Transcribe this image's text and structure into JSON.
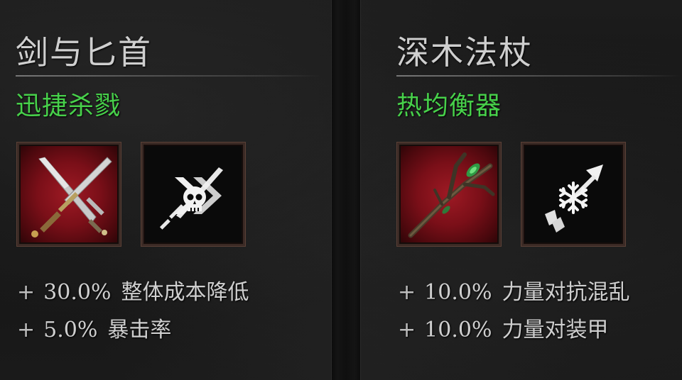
{
  "left_panel": {
    "title": "剑与匕首",
    "subtitle": "迅捷杀戮",
    "item_icon": "crossed-sword-dagger-icon",
    "effect_icon": "skull-dagger-icon",
    "stats": [
      {
        "prefix": "+",
        "value": "30.0%",
        "label": "整体成本降低"
      },
      {
        "prefix": "+",
        "value": "5.0%",
        "label": "暴击率"
      }
    ]
  },
  "right_panel": {
    "title": "深木法杖",
    "subtitle": "热均衡器",
    "item_icon": "deepwood-staff-icon",
    "effect_icon": "frost-arrow-icon",
    "stats": [
      {
        "prefix": "+",
        "value": "10.0%",
        "label": "力量对抗混乱"
      },
      {
        "prefix": "+",
        "value": "10.0%",
        "label": "力量对装甲"
      }
    ]
  },
  "colors": {
    "title": "#cfcfcf",
    "subtitle_green": "#47d04a",
    "item_slot_red": "#9e1a24",
    "effect_slot_black": "#0a0a0a"
  }
}
